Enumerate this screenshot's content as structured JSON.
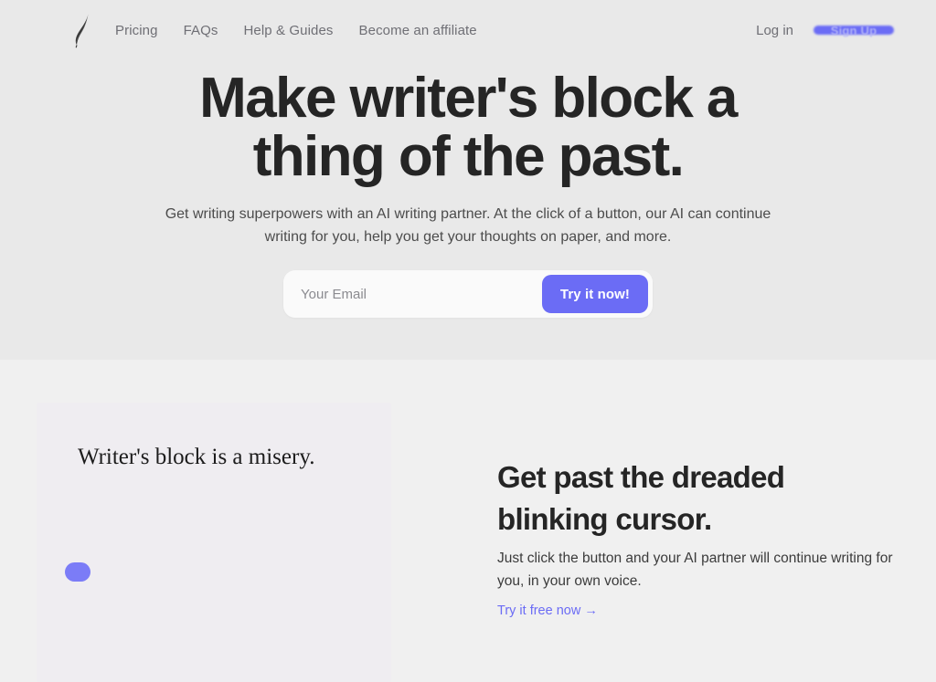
{
  "header": {
    "logo_icon": "feather-quill-icon",
    "nav_links": [
      {
        "label": "Pricing"
      },
      {
        "label": "FAQs"
      },
      {
        "label": "Help & Guides"
      },
      {
        "label": "Become an affiliate"
      }
    ],
    "login_label": "Log in",
    "signup_label": "Sign Up"
  },
  "hero": {
    "title_line1": "Make writer's block a",
    "title_line2": "thing of the past.",
    "subtitle": "Get writing superpowers with an AI writing partner. At the click of a button, our AI can continue writing for you, help you get your thoughts on paper, and more.",
    "form": {
      "email_value": "",
      "email_placeholder": "Your Email",
      "submit_label": "Try it now!"
    }
  },
  "feature": {
    "card": {
      "quote": "Writer's block is a misery.",
      "dot_icon": "purple-dot-indicator"
    },
    "title_line1": "Get past the dreaded",
    "title_line2": "blinking cursor.",
    "body": "Just click the button and your AI partner will continue writing for you, in your own voice.",
    "link_label": "Try it free now →"
  },
  "colors": {
    "accent": "#6b6cf5",
    "hero_background": "#e9e9e9",
    "section_background": "#f0f0f0",
    "card_background": "#efedf1",
    "heading": "#252525",
    "nav_text": "#6f6f75"
  }
}
